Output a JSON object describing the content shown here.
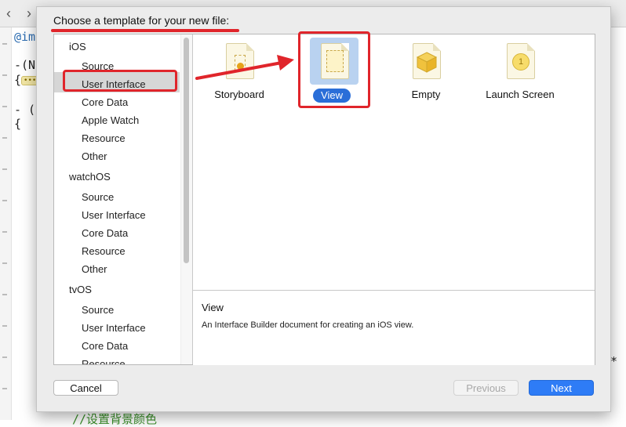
{
  "editor": {
    "nav_back": "‹",
    "nav_forward": "›",
    "code_lines": [
      "@im",
      "-(N",
      "{",
      "- (",
      "{"
    ],
    "fold_marker": "•••",
    "comment": "//设置背景颜色",
    "asterisk": "*"
  },
  "dialog": {
    "title": "Choose a template for your new file:",
    "sidebar": [
      {
        "category": "iOS",
        "items": [
          "Source",
          "User Interface",
          "Core Data",
          "Apple Watch",
          "Resource",
          "Other"
        ]
      },
      {
        "category": "watchOS",
        "items": [
          "Source",
          "User Interface",
          "Core Data",
          "Resource",
          "Other"
        ]
      },
      {
        "category": "tvOS",
        "items": [
          "Source",
          "User Interface",
          "Core Data",
          "Resource"
        ]
      }
    ],
    "selected_sidebar_item": "User Interface",
    "templates": [
      "Storyboard",
      "View",
      "Empty",
      "Launch Screen"
    ],
    "selected_template": "View",
    "description_title": "View",
    "description_text": "An Interface Builder document for creating an iOS view.",
    "buttons": {
      "cancel": "Cancel",
      "previous": "Previous",
      "next": "Next"
    }
  },
  "colors": {
    "accent": "#2e7cf6",
    "callout": "#e0252b"
  },
  "icons": {
    "storyboard": "storyboard-icon",
    "view": "view-icon",
    "empty": "empty-cube-icon",
    "launch_screen": "launch-screen-icon"
  }
}
